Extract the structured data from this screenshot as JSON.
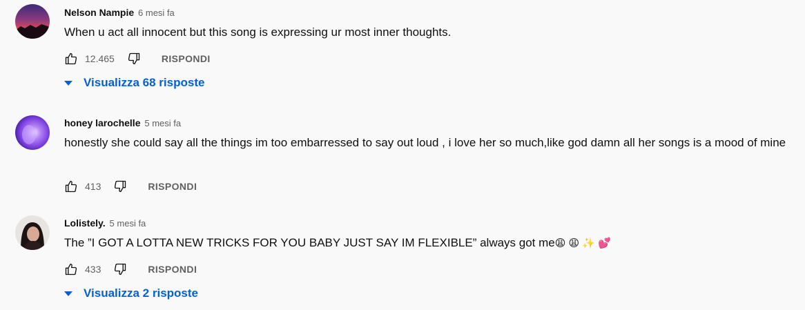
{
  "comments": [
    {
      "author": "Nelson Nampie",
      "time": "6 mesi fa",
      "text": "When u act all innocent but this song is expressing ur most  inner thoughts.",
      "likes": "12.465",
      "reply_label": "RISPONDI",
      "replies_label": "Visualizza 68 risposte",
      "avatar": "sunset-avatar"
    },
    {
      "author": "honey larochelle",
      "time": "5 mesi fa",
      "text": "honestly she could say all the things im too embarressed to say out loud , i love her so much,like god damn all  her songs is a mood of mine",
      "likes": "413",
      "reply_label": "RISPONDI",
      "avatar": "purple-glow-avatar"
    },
    {
      "author": "Lolistely.",
      "time": "5 mesi fa",
      "text": "The ”I GOT A LOTTA NEW TRICKS FOR YOU BABY JUST SAY IM FLEXIBLE” always got me",
      "emojis": "😩 😩 ✨ 💕",
      "likes": "433",
      "reply_label": "RISPONDI",
      "replies_label": "Visualizza 2 risposte",
      "avatar": "portrait-avatar"
    }
  ],
  "colors": {
    "background": "#f9f9f9",
    "link_blue": "#065fd4",
    "secondary_text": "#606060"
  }
}
